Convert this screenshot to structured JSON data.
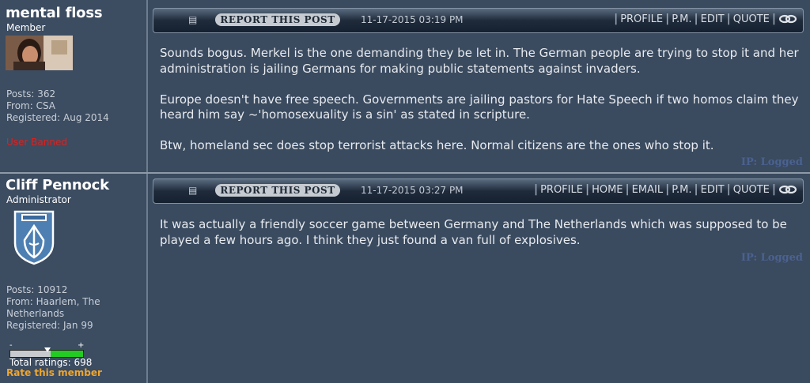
{
  "posts": [
    {
      "username": "mental floss",
      "role": "Member",
      "stats": [
        "Posts: 362",
        "From: CSA",
        "Registered: Aug 2014"
      ],
      "status": "User Banned",
      "report_label": "REPORT THIS POST",
      "date": "11-17-2015 03:19 PM",
      "links": [
        "PROFILE",
        "P.M.",
        "EDIT",
        "QUOTE"
      ],
      "paragraphs": [
        "Sounds bogus. Merkel is the one demanding they be let in. The German people are trying to stop it and her administration is jailing Germans for making public statements against invaders.",
        "Europe doesn't have free speech. Governments are jailing pastors for Hate Speech if two homos claim they heard him say ~'homosexuality is a sin' as stated in scripture.",
        "Btw, homeland sec does stop terrorist attacks here. Normal citizens are the ones who stop it."
      ],
      "ip": "IP: Logged"
    },
    {
      "username": "Cliff Pennock",
      "role": "Administrator",
      "stats": [
        "Posts: 10912",
        "From: Haarlem, The",
        "Netherlands",
        "Registered: Jan 99"
      ],
      "report_label": "REPORT THIS POST",
      "date": "11-17-2015 03:27 PM",
      "links": [
        "PROFILE",
        "HOME",
        "EMAIL",
        "P.M.",
        "EDIT",
        "QUOTE"
      ],
      "paragraphs": [
        "It was actually a friendly soccer game between Germany and The Netherlands which was supposed to be played a few hours ago. I think they just found a van full of explosives."
      ],
      "ip": "IP: Logged",
      "rating": {
        "minus": "-",
        "plus": "+",
        "fraction": 0.45,
        "total": "Total ratings: 698",
        "rate_link": "Rate this member"
      }
    }
  ],
  "colors": {
    "banned": "#e0201c",
    "rate_link": "#f0a52c",
    "rating_positive": "#22cc22",
    "ip": "#4a6290"
  }
}
